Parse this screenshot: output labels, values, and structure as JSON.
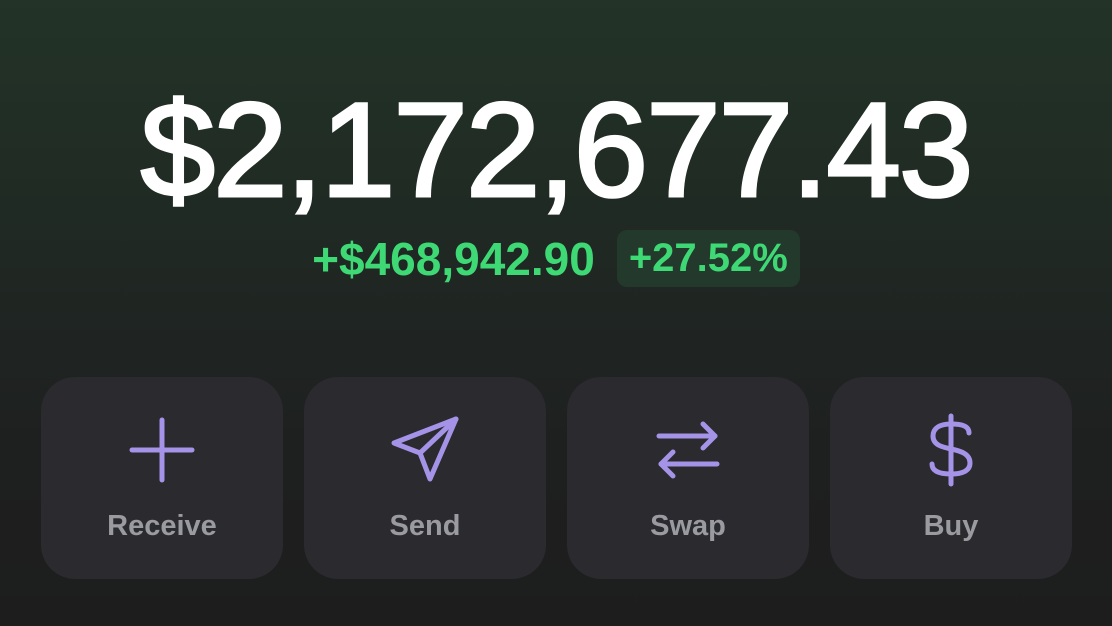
{
  "wallet": {
    "balance": "$2,172,677.43",
    "change_amount": "+$468,942.90",
    "change_percent": "+27.52%"
  },
  "actions": [
    {
      "label": "Receive",
      "icon": "plus-icon"
    },
    {
      "label": "Send",
      "icon": "paper-plane-icon"
    },
    {
      "label": "Swap",
      "icon": "swap-arrows-icon"
    },
    {
      "label": "Buy",
      "icon": "dollar-icon"
    }
  ],
  "colors": {
    "accent": "#a593e8",
    "positive": "#3ed975",
    "card": "#2a2a2f",
    "label": "#9a9aa1"
  }
}
